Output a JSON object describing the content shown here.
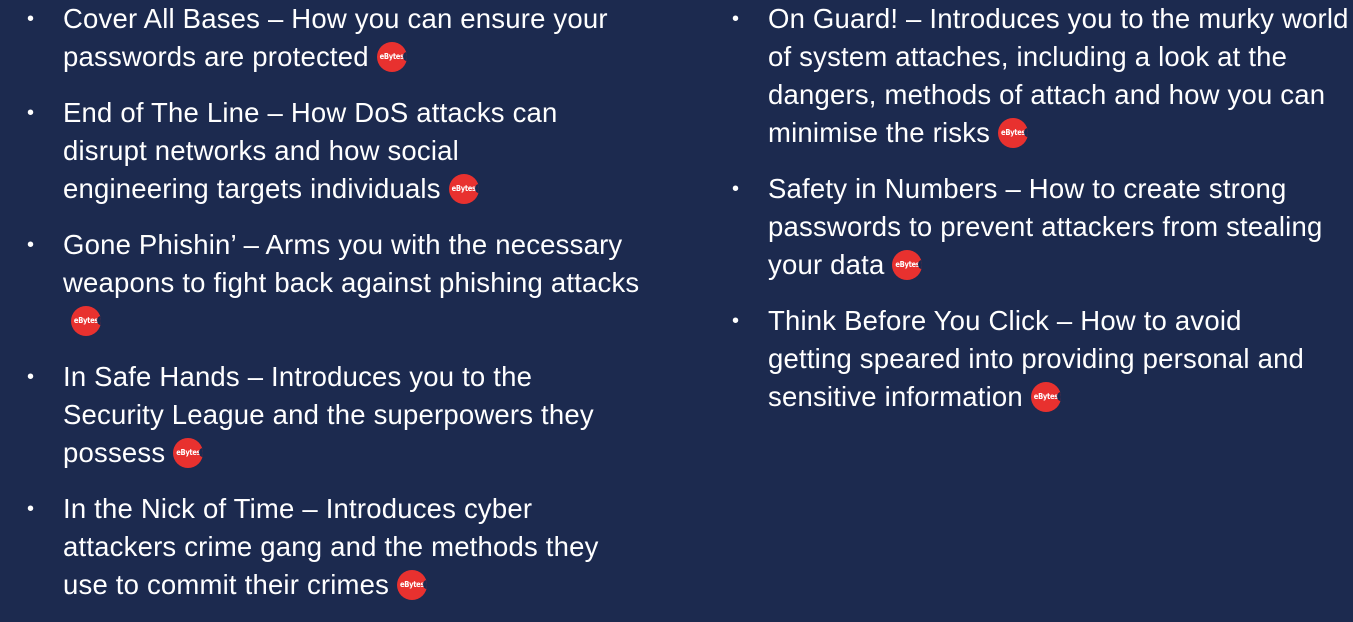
{
  "badge_text": "eBytes",
  "colors": {
    "background": "#1c2a4f",
    "text": "#ffffff",
    "badge": "#e8312f"
  },
  "left_items": [
    {
      "text": "Cover All Bases – How you can ensure your passwords are protected"
    },
    {
      "text": "End of The Line – How DoS attacks can disrupt networks and how social engineering targets individuals"
    },
    {
      "text": "Gone Phishin’ – Arms you with the necessary weapons to fight back against phishing attacks"
    },
    {
      "text": "In Safe Hands – Introduces you to the Security League and the superpowers they possess"
    },
    {
      "text": "In the Nick of Time – Introduces cyber attackers crime gang and the methods they use to commit their crimes"
    }
  ],
  "right_items": [
    {
      "text": "On Guard! – Introduces you to the murky world of system attaches, including a look at the dangers, methods of attach and how you can minimise the risks"
    },
    {
      "text": "Safety in Numbers – How to create strong passwords to prevent attackers from stealing your data"
    },
    {
      "text": "Think Before You Click – How to avoid getting speared into providing personal and sensitive information"
    }
  ]
}
